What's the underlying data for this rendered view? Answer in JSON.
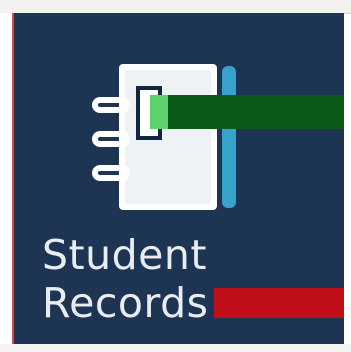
{
  "tile": {
    "title_line1": "Student",
    "title_line2": "Records",
    "icon": "notebook-icon",
    "colors": {
      "tile_background": "#1d3552",
      "notebook_strip": "#35a3cc",
      "text": "#e9edf2"
    }
  }
}
